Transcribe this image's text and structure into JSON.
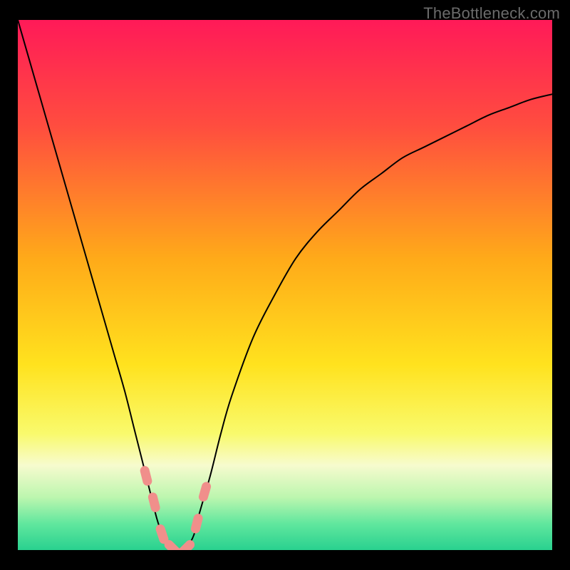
{
  "watermark": "TheBottleneck.com",
  "chart_data": {
    "type": "line",
    "title": "",
    "xlabel": "",
    "ylabel": "",
    "xlim": [
      0,
      100
    ],
    "ylim": [
      0,
      100
    ],
    "grid": false,
    "legend": false,
    "background": {
      "type": "vertical-gradient",
      "stops": [
        {
          "offset": 0.0,
          "color": "#ff1a58"
        },
        {
          "offset": 0.2,
          "color": "#ff4d3f"
        },
        {
          "offset": 0.45,
          "color": "#ffaa19"
        },
        {
          "offset": 0.65,
          "color": "#ffe21e"
        },
        {
          "offset": 0.78,
          "color": "#f9fa6c"
        },
        {
          "offset": 0.84,
          "color": "#f7fbce"
        },
        {
          "offset": 0.9,
          "color": "#bdf6af"
        },
        {
          "offset": 0.95,
          "color": "#61e79e"
        },
        {
          "offset": 1.0,
          "color": "#29d18f"
        }
      ]
    },
    "series": [
      {
        "name": "bottleneck-curve",
        "color": "#000000",
        "width": 2,
        "x": [
          0,
          2,
          4,
          6,
          8,
          10,
          12,
          14,
          16,
          18,
          20,
          22,
          24,
          25,
          26,
          27,
          28,
          29,
          30,
          31,
          32,
          33,
          34,
          36,
          38,
          40,
          44,
          48,
          52,
          56,
          60,
          64,
          68,
          72,
          76,
          80,
          84,
          88,
          92,
          96,
          100
        ],
        "y": [
          100,
          93,
          86,
          79,
          72,
          65,
          58,
          51,
          44,
          37,
          30,
          22,
          14,
          10,
          6,
          3,
          1,
          0,
          0,
          0,
          1,
          3,
          7,
          14,
          22,
          29,
          40,
          48,
          55,
          60,
          64,
          68,
          71,
          74,
          76,
          78,
          80,
          82,
          83.5,
          85,
          86
        ]
      }
    ],
    "markers": {
      "name": "bottleneck-range-markers",
      "color": "#f08f8b",
      "shape": "rounded-dash",
      "points": [
        {
          "x": 24.0,
          "y": 14
        },
        {
          "x": 25.5,
          "y": 9
        },
        {
          "x": 27.0,
          "y": 3
        },
        {
          "x": 29.0,
          "y": 0.3
        },
        {
          "x": 31.5,
          "y": 0.3
        },
        {
          "x": 33.5,
          "y": 5
        },
        {
          "x": 35.0,
          "y": 11
        }
      ]
    }
  }
}
